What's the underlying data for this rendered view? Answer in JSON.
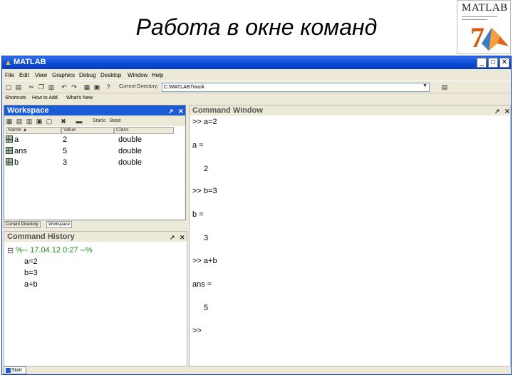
{
  "slide": {
    "title": "Работа в окне команд",
    "logo_text": "MATLAB",
    "logo_number": "7"
  },
  "window": {
    "title": "MATLAB",
    "buttons": {
      "minimize": "_",
      "maximize": "□",
      "close": "✕"
    }
  },
  "menu": [
    "File",
    "Edit",
    "View",
    "Graphics",
    "Debug",
    "Desktop",
    "Window",
    "Help"
  ],
  "toolbar": {
    "current_dir_label": "Current Directory:",
    "current_dir_value": "C:\\MATLAB7\\work"
  },
  "shortcuts": {
    "label": "Shortcuts",
    "items": [
      "How to Add",
      "What's New"
    ]
  },
  "workspace": {
    "title": "Workspace",
    "stack_label": "Stack:",
    "stack_value": "Base",
    "columns": [
      "Name ▲",
      "Value",
      "Class"
    ],
    "rows": [
      {
        "name": "a",
        "value": "2",
        "class": "double"
      },
      {
        "name": "ans",
        "value": "5",
        "class": "double"
      },
      {
        "name": "b",
        "value": "3",
        "class": "double"
      }
    ],
    "tabs": [
      "Current Directory",
      "Workspace"
    ]
  },
  "command_history": {
    "title": "Command History",
    "session": "%-- 17.04.12 0:27 --%",
    "entries": [
      "a=2",
      "b=3",
      "a+b"
    ]
  },
  "command_window": {
    "title": "Command Window",
    "lines": [
      ">> a=2",
      "a =",
      "2",
      ">> b=3",
      "b =",
      "3",
      ">> a+b",
      "ans =",
      "5",
      ">>"
    ]
  },
  "status": {
    "start_label": "Start"
  },
  "colors": {
    "titlebar": "#0a4ad4",
    "workspace_header": "#1a5bd6",
    "history_session": "#1a8a1a",
    "logo_accent": "#d65a14"
  }
}
